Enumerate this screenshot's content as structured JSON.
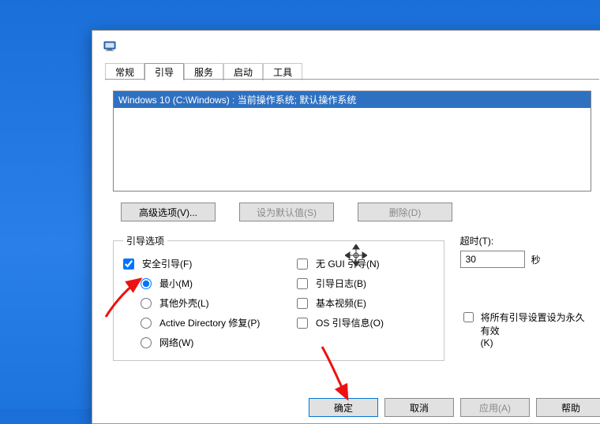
{
  "tabs": {
    "general": "常规",
    "boot": "引导",
    "services": "服务",
    "startup": "启动",
    "tools": "工具"
  },
  "boot_entry": "Windows 10 (C:\\Windows) : 当前操作系统; 默认操作系统",
  "buttons": {
    "advanced": "高级选项(V)...",
    "set_default": "设为默认值(S)",
    "delete": "删除(D)",
    "ok": "确定",
    "cancel": "取消",
    "apply": "应用(A)",
    "help": "帮助"
  },
  "group": {
    "boot_options_title": "引导选项",
    "safe_boot": "安全引导(F)",
    "minimal": "最小(M)",
    "alt_shell": "其他外壳(L)",
    "ad_repair": "Active Directory 修复(P)",
    "network": "网络(W)",
    "no_gui": "无 GUI 引导(N)",
    "boot_log": "引导日志(B)",
    "base_video": "基本视频(E)",
    "os_boot_info": "OS 引导信息(O)"
  },
  "timeout": {
    "label": "超时(T):",
    "value": "30",
    "unit": "秒"
  },
  "permanent": {
    "line1": "将所有引导设置设为永久有效",
    "line2": "(K)"
  }
}
